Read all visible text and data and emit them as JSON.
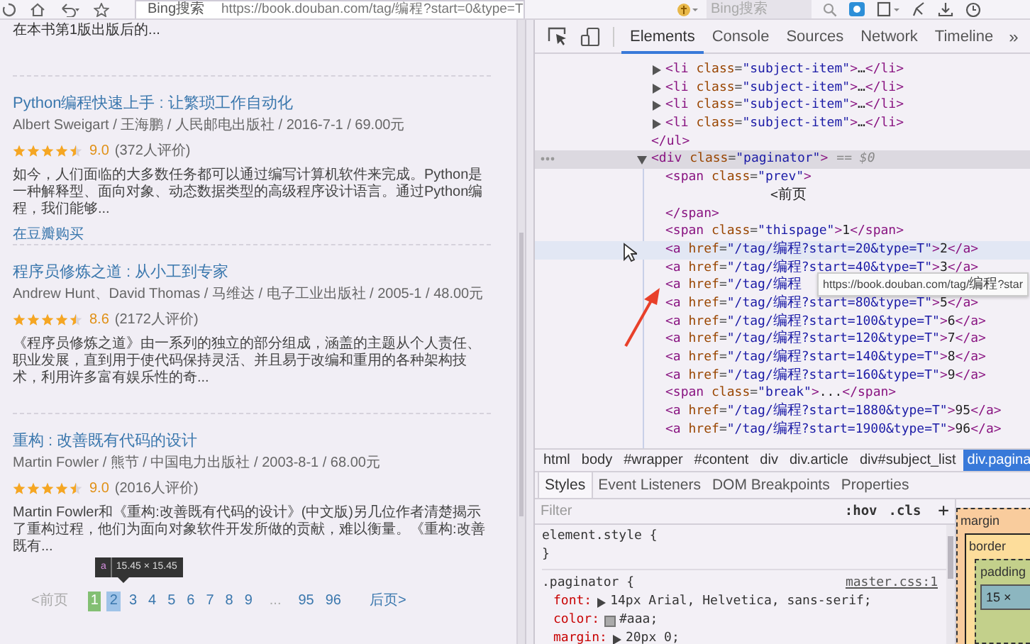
{
  "browser_toolbar": {
    "engine_label": "Bing搜索",
    "address": "https://book.douban.com/tag/编程?start=0&type=T",
    "search_placeholder": "Bing搜索"
  },
  "book_list": {
    "intro_tail": "在本书第1版出版后的...",
    "books": [
      {
        "title": "Python编程快速上手 : 让繁琐工作自动化",
        "meta": "Albert Sweigart / 王海鹏 / 人民邮电出版社 / 2016-7-1 / 69.00元",
        "stars": 4.5,
        "rating": "9.0",
        "rating_count": "(372人评价)",
        "description": "如今，人们面临的大多数任务都可以通过编写计算机软件来完成。Python是一种解释型、面向对象、动态数据类型的高级程序设计语言。通过Python编程，我们能够...",
        "buy_link": "在豆瓣购买"
      },
      {
        "title": "程序员修炼之道 : 从小工到专家",
        "meta": "Andrew Hunt、David Thomas / 马维达 / 电子工业出版社 / 2005-1 / 48.00元",
        "stars": 4.5,
        "rating": "8.6",
        "rating_count": "(2172人评价)",
        "description": "《程序员修炼之道》由一系列的独立的部分组成，涵盖的主题从个人责任、职业发展，直到用于使代码保持灵活、并且易于改编和重用的各种架构技术，利用许多富有娱乐性的奇..."
      },
      {
        "title": "重构 : 改善既有代码的设计",
        "meta": "Martin Fowler / 熊节 / 中国电力出版社 / 2003-8-1 / 68.00元",
        "stars": 4.5,
        "rating": "9.0",
        "rating_count": "(2016人评价)",
        "description": "Martin Fowler和《重构:改善既有代码的设计》(中文版)另几位作者清楚揭示了重构过程，他们为面向对象软件开发所做的贡献，难以衡量。《重构:改善既有..."
      }
    ],
    "element_tooltip": {
      "tag": "a",
      "size": "15.45 × 15.45"
    },
    "paginator": {
      "prev": "<前页",
      "next": "后页>",
      "pages": [
        {
          "label": "1",
          "kind": "current",
          "highlighted": false
        },
        {
          "label": "2",
          "kind": "link",
          "highlighted": true
        },
        {
          "label": "3",
          "kind": "link",
          "highlighted": false
        },
        {
          "label": "4",
          "kind": "link",
          "highlighted": false
        },
        {
          "label": "5",
          "kind": "link",
          "highlighted": false
        },
        {
          "label": "6",
          "kind": "link",
          "highlighted": false
        },
        {
          "label": "7",
          "kind": "link",
          "highlighted": false
        },
        {
          "label": "8",
          "kind": "link",
          "highlighted": false
        },
        {
          "label": "9",
          "kind": "link",
          "highlighted": false
        },
        {
          "label": "...",
          "kind": "break",
          "highlighted": false
        },
        {
          "label": "95",
          "kind": "link",
          "highlighted": false
        },
        {
          "label": "96",
          "kind": "link",
          "highlighted": false
        }
      ]
    }
  },
  "devtools": {
    "tabs": [
      {
        "label": "Elements",
        "selected": true
      },
      {
        "label": "Console",
        "selected": false
      },
      {
        "label": "Sources",
        "selected": false
      },
      {
        "label": "Network",
        "selected": false
      },
      {
        "label": "Timeline",
        "selected": false
      }
    ],
    "more_tabs": "»",
    "dom_tree": [
      {
        "selected": false,
        "hovered": false,
        "close": "</ul>",
        "children": [
          {
            "open": "<li class=\"subject-item\">…</li>",
            "expanded": false,
            "selected": false,
            "hovered": false
          },
          {
            "open": "<li class=\"subject-item\">…</li>",
            "expanded": false,
            "selected": false,
            "hovered": false
          },
          {
            "open": "<li class=\"subject-item\">…</li>",
            "expanded": false,
            "selected": false,
            "hovered": false
          },
          {
            "open": "<li class=\"subject-item\">…</li>",
            "expanded": false,
            "selected": false,
            "hovered": false
          }
        ]
      },
      {
        "open": "<div class=\"paginator\">",
        "badge": "== $0",
        "expanded": true,
        "selected": true,
        "hovered": false,
        "children": [
          {
            "open": "<span class=\"prev\">",
            "close": "</span>",
            "selected": false,
            "hovered": false,
            "children": [
              {
                "open": "<前页",
                "kind": "text",
                "selected": false,
                "hovered": false
              }
            ]
          },
          {
            "open": "<span class=\"thispage\">1</span>",
            "selected": false,
            "hovered": false
          },
          {
            "open": "<a href=\"/tag/编程?start=20&type=T\">2</a>",
            "selected": false,
            "hovered": true
          },
          {
            "open": "<a href=\"/tag/编程?start=40&type=T\">3</a>",
            "selected": false,
            "hovered": false
          },
          {
            "open": "<a href=\"/tag/编程",
            "tooltip": "https://book.douban.com/tag/编程?star",
            "selected": false,
            "hovered": false
          },
          {
            "open": "<a href=\"/tag/编程?start=80&type=T\">5</a>",
            "selected": false,
            "hovered": false
          },
          {
            "open": "<a href=\"/tag/编程?start=100&type=T\">6</a>",
            "selected": false,
            "hovered": false
          },
          {
            "open": "<a href=\"/tag/编程?start=120&type=T\">7</a>",
            "selected": false,
            "hovered": false
          },
          {
            "open": "<a href=\"/tag/编程?start=140&type=T\">8</a>",
            "selected": false,
            "hovered": false
          },
          {
            "open": "<a href=\"/tag/编程?start=160&type=T\">9</a>",
            "selected": false,
            "hovered": false
          },
          {
            "open": "<span class=\"break\">...</span>",
            "selected": false,
            "hovered": false
          },
          {
            "open": "<a href=\"/tag/编程?start=1880&type=T\">95</a>",
            "selected": false,
            "hovered": false
          },
          {
            "open": "<a href=\"/tag/编程?start=1900&type=T\">96</a>",
            "selected": false,
            "hovered": false
          }
        ]
      }
    ],
    "breadcrumbs": [
      {
        "label": "html",
        "selected": false
      },
      {
        "label": "body",
        "selected": false
      },
      {
        "label": "#wrapper",
        "selected": false
      },
      {
        "label": "#content",
        "selected": false
      },
      {
        "label": "div",
        "selected": false
      },
      {
        "label": "div.article",
        "selected": false
      },
      {
        "label": "div#subject_list",
        "selected": false
      },
      {
        "label": "div.pagina",
        "selected": true
      }
    ],
    "styles_tabs": [
      {
        "label": "Styles",
        "selected": true
      },
      {
        "label": "Event Listeners",
        "selected": false
      },
      {
        "label": "DOM Breakpoints",
        "selected": false
      },
      {
        "label": "Properties",
        "selected": false
      }
    ],
    "filter_placeholder": "Filter",
    "hov_toggle": ":hov",
    "cls_toggle": ".cls",
    "add_rule": "+",
    "rules": [
      {
        "header": "element.style {",
        "closing": "}"
      },
      {
        "header": ".paginator {",
        "source": "master.css:1",
        "declarations": [
          {
            "name": "font:",
            "value": "14px Arial, Helvetica, sans-serif;",
            "expandable": true
          },
          {
            "name": "color:",
            "value": "#aaa;",
            "color": "#aaaaaa"
          },
          {
            "name": "margin:",
            "value": "20px 0;",
            "expandable": true
          }
        ]
      }
    ],
    "box_model": {
      "margin_label": "margin",
      "border_label": "border",
      "padding_label": "padding",
      "content": "15 ×"
    }
  }
}
